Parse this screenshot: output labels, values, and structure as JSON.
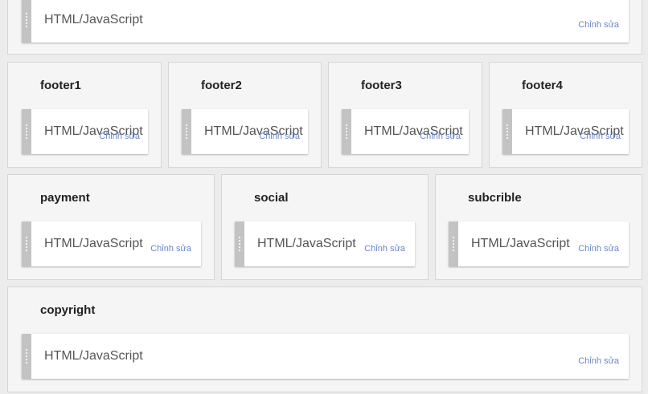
{
  "sections": {
    "top": {
      "widget_label": "HTML/JavaScript",
      "edit_label": "Chỉnh sửa"
    },
    "footer1": {
      "title": "footer1",
      "widget_label": "HTML/JavaScript",
      "edit_label": "Chỉnh sửa"
    },
    "footer2": {
      "title": "footer2",
      "widget_label": "HTML/JavaScript",
      "edit_label": "Chỉnh sửa"
    },
    "footer3": {
      "title": "footer3",
      "widget_label": "HTML/JavaScript",
      "edit_label": "Chỉnh sửa"
    },
    "footer4": {
      "title": "footer4",
      "widget_label": "HTML/JavaScript",
      "edit_label": "Chỉnh sửa"
    },
    "payment": {
      "title": "payment",
      "widget_label": "HTML/JavaScript",
      "edit_label": "Chỉnh sửa"
    },
    "social": {
      "title": "social",
      "widget_label": "HTML/JavaScript",
      "edit_label": "Chỉnh sửa"
    },
    "subcrible": {
      "title": "subcrible",
      "widget_label": "HTML/JavaScript",
      "edit_label": "Chỉnh sửa"
    },
    "copyright": {
      "title": "copyright",
      "widget_label": "HTML/JavaScript",
      "edit_label": "Chỉnh sửa"
    }
  },
  "colors": {
    "page_background": "#ececec",
    "section_background": "#f5f5f5",
    "handle": "#c3c3c3",
    "edit_link": "#6a86c4"
  },
  "icons": {
    "drag_handle": "drag-handle-icon"
  }
}
